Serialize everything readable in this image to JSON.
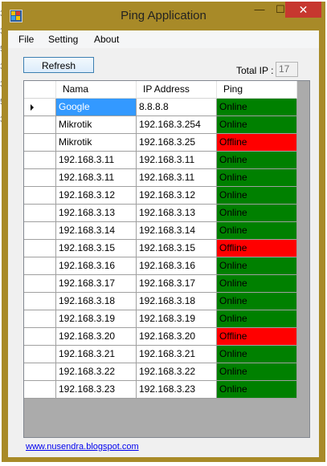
{
  "window": {
    "title": "Ping Application",
    "controls": {
      "minimize": "—",
      "maximize": "☐",
      "close": "✕"
    }
  },
  "menu": [
    "File",
    "Setting",
    "About"
  ],
  "toolbar": {
    "refresh_label": "Refresh",
    "total_label": "Total IP :",
    "total_value": "17"
  },
  "grid": {
    "columns": [
      "Nama",
      "IP Address",
      "Ping"
    ],
    "rows": [
      {
        "nama": "Google",
        "ip": "8.8.8.8",
        "ping": "Online"
      },
      {
        "nama": "Mikrotik",
        "ip": "192.168.3.254",
        "ping": "Online"
      },
      {
        "nama": "Mikrotik",
        "ip": "192.168.3.25",
        "ping": "Offline"
      },
      {
        "nama": "192.168.3.11",
        "ip": "192.168.3.11",
        "ping": "Online"
      },
      {
        "nama": "192.168.3.11",
        "ip": "192.168.3.11",
        "ping": "Online"
      },
      {
        "nama": "192.168.3.12",
        "ip": "192.168.3.12",
        "ping": "Online"
      },
      {
        "nama": "192.168.3.13",
        "ip": "192.168.3.13",
        "ping": "Online"
      },
      {
        "nama": "192.168.3.14",
        "ip": "192.168.3.14",
        "ping": "Online"
      },
      {
        "nama": "192.168.3.15",
        "ip": "192.168.3.15",
        "ping": "Offline"
      },
      {
        "nama": "192.168.3.16",
        "ip": "192.168.3.16",
        "ping": "Online"
      },
      {
        "nama": "192.168.3.17",
        "ip": "192.168.3.17",
        "ping": "Online"
      },
      {
        "nama": "192.168.3.18",
        "ip": "192.168.3.18",
        "ping": "Online"
      },
      {
        "nama": "192.168.3.19",
        "ip": "192.168.3.19",
        "ping": "Online"
      },
      {
        "nama": "192.168.3.20",
        "ip": "192.168.3.20",
        "ping": "Offline"
      },
      {
        "nama": "192.168.3.21",
        "ip": "192.168.3.21",
        "ping": "Online"
      },
      {
        "nama": "192.168.3.22",
        "ip": "192.168.3.22",
        "ping": "Online"
      },
      {
        "nama": "192.168.3.23",
        "ip": "192.168.3.23",
        "ping": "Online"
      }
    ],
    "selected_row": 0
  },
  "status_colors": {
    "Online": "#008000",
    "Offline": "#ff0000"
  },
  "footer_link": "www.nusendra.blogspot.com",
  "background_digits": [
    "3/",
    "3/",
    "5/",
    "3/",
    "3/",
    "5/",
    "3/"
  ]
}
